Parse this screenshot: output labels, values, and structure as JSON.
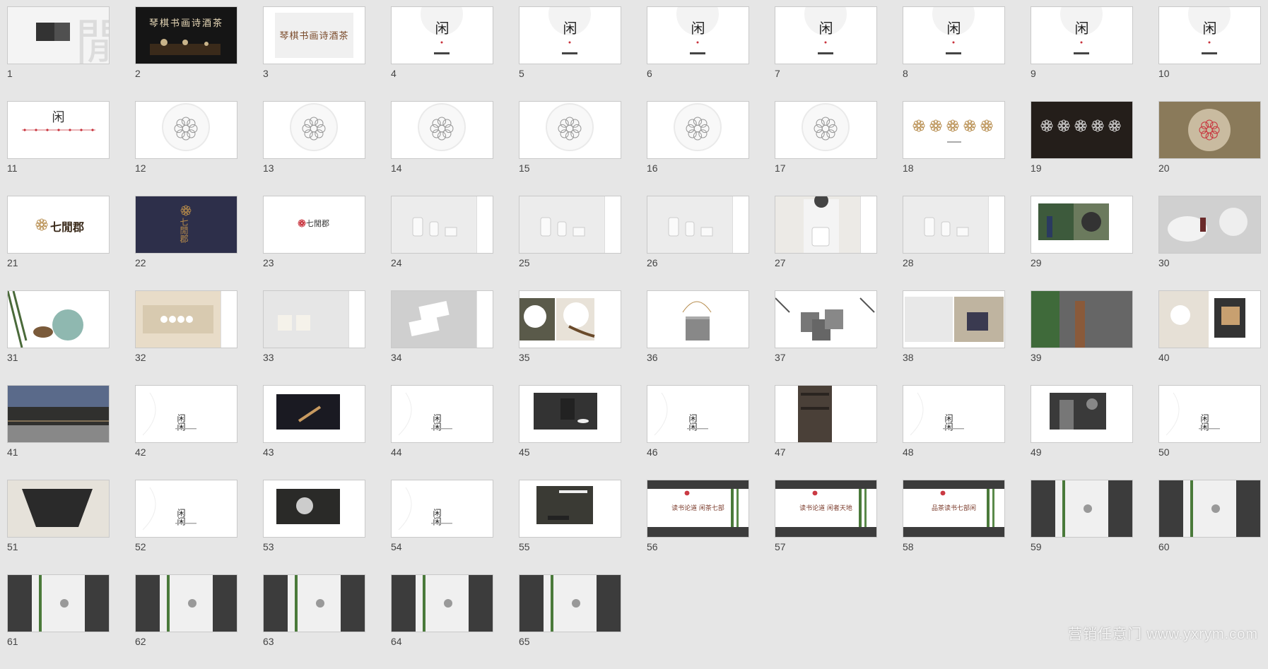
{
  "watermark": "营销任意门 www.yxrym.com",
  "slide_text": {
    "s2": "琴棋书画诗酒茶",
    "s3": "琴棋书画诗酒茶",
    "logo_glyph": "闲",
    "brand_cn": "七閒郡",
    "s1_glyph": "閒",
    "s56": "读书论道 闲茶七部",
    "s57": "读书论道 闲者天地",
    "s58": "品茶读书七部闲"
  },
  "slides": [
    {
      "number": "1",
      "kind": "s1"
    },
    {
      "number": "2",
      "kind": "s2"
    },
    {
      "number": "3",
      "kind": "s3"
    },
    {
      "number": "4",
      "kind": "arc"
    },
    {
      "number": "5",
      "kind": "arc"
    },
    {
      "number": "6",
      "kind": "arc"
    },
    {
      "number": "7",
      "kind": "arc"
    },
    {
      "number": "8",
      "kind": "arc"
    },
    {
      "number": "9",
      "kind": "arc"
    },
    {
      "number": "10",
      "kind": "arc"
    },
    {
      "number": "11",
      "kind": "timeline"
    },
    {
      "number": "12",
      "kind": "circle"
    },
    {
      "number": "13",
      "kind": "circle"
    },
    {
      "number": "14",
      "kind": "circle"
    },
    {
      "number": "15",
      "kind": "circle"
    },
    {
      "number": "16",
      "kind": "circle"
    },
    {
      "number": "17",
      "kind": "circle"
    },
    {
      "number": "18",
      "kind": "rosettes-light"
    },
    {
      "number": "19",
      "kind": "rosettes-dark"
    },
    {
      "number": "20",
      "kind": "bronze"
    },
    {
      "number": "21",
      "kind": "brand-light"
    },
    {
      "number": "22",
      "kind": "brand-navy"
    },
    {
      "number": "23",
      "kind": "brand-small"
    },
    {
      "number": "24",
      "kind": "product"
    },
    {
      "number": "25",
      "kind": "product"
    },
    {
      "number": "26",
      "kind": "product"
    },
    {
      "number": "27",
      "kind": "photo-person"
    },
    {
      "number": "28",
      "kind": "product"
    },
    {
      "number": "29",
      "kind": "photo-mixed"
    },
    {
      "number": "30",
      "kind": "photo-bag"
    },
    {
      "number": "31",
      "kind": "photo-jar"
    },
    {
      "number": "32",
      "kind": "photo-tea"
    },
    {
      "number": "33",
      "kind": "photo-bags"
    },
    {
      "number": "34",
      "kind": "card"
    },
    {
      "number": "35",
      "kind": "photo-fan"
    },
    {
      "number": "36",
      "kind": "photo-can"
    },
    {
      "number": "37",
      "kind": "photo-cans"
    },
    {
      "number": "38",
      "kind": "photo-box"
    },
    {
      "number": "39",
      "kind": "photo-wall"
    },
    {
      "number": "40",
      "kind": "photo-gift"
    },
    {
      "number": "41",
      "kind": "photo-arch"
    },
    {
      "number": "42",
      "kind": "calli"
    },
    {
      "number": "43",
      "kind": "photo-dark"
    },
    {
      "number": "44",
      "kind": "calli"
    },
    {
      "number": "45",
      "kind": "photo-room"
    },
    {
      "number": "46",
      "kind": "calli"
    },
    {
      "number": "47",
      "kind": "photo-shelf"
    },
    {
      "number": "48",
      "kind": "calli"
    },
    {
      "number": "49",
      "kind": "photo-interior"
    },
    {
      "number": "50",
      "kind": "calli"
    },
    {
      "number": "51",
      "kind": "photo-fanart"
    },
    {
      "number": "52",
      "kind": "calli"
    },
    {
      "number": "53",
      "kind": "photo-moon"
    },
    {
      "number": "54",
      "kind": "calli"
    },
    {
      "number": "55",
      "kind": "photo-tearoom"
    },
    {
      "number": "56",
      "kind": "banner"
    },
    {
      "number": "57",
      "kind": "banner"
    },
    {
      "number": "58",
      "kind": "banner"
    },
    {
      "number": "59",
      "kind": "vertical"
    },
    {
      "number": "60",
      "kind": "vertical"
    },
    {
      "number": "61",
      "kind": "vertical"
    },
    {
      "number": "62",
      "kind": "vertical"
    },
    {
      "number": "63",
      "kind": "vertical"
    },
    {
      "number": "64",
      "kind": "vertical"
    },
    {
      "number": "65",
      "kind": "vertical"
    }
  ],
  "colors": {
    "background": "#e6e6e6",
    "accent_red": "#c8323c",
    "gold": "#b58a4a",
    "navy": "#2d2f4a",
    "dark_bar": "#3c3c3c"
  }
}
